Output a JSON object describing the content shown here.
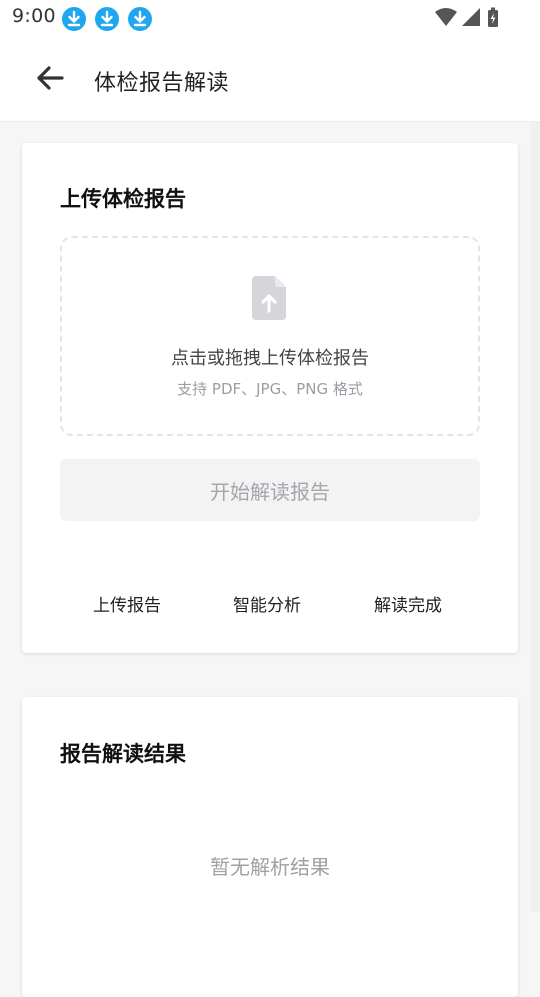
{
  "status_bar": {
    "time": "9:00",
    "notification_icons": [
      "download-icon",
      "download-icon",
      "download-icon"
    ],
    "system_icons": [
      "wifi-icon",
      "signal-icon",
      "battery-icon"
    ]
  },
  "header": {
    "title": "体检报告解读",
    "back_icon": "arrow-left-icon"
  },
  "upload_card": {
    "title": "上传体检报告",
    "dropzone": {
      "main_text": "点击或拖拽上传体检报告",
      "sub_text": "支持 PDF、JPG、PNG 格式",
      "icon": "file-upload-icon"
    },
    "start_button_label": "开始解读报告",
    "steps": [
      {
        "label": "上传报告"
      },
      {
        "label": "智能分析"
      },
      {
        "label": "解读完成"
      }
    ]
  },
  "result_card": {
    "title": "报告解读结果",
    "empty_text": "暂无解析结果"
  },
  "colors": {
    "accent_download": "#1ea7f0",
    "placeholder_gray": "#9ea1a6",
    "button_bg": "#f3f3f4",
    "dash_border": "#e3e4e6"
  }
}
